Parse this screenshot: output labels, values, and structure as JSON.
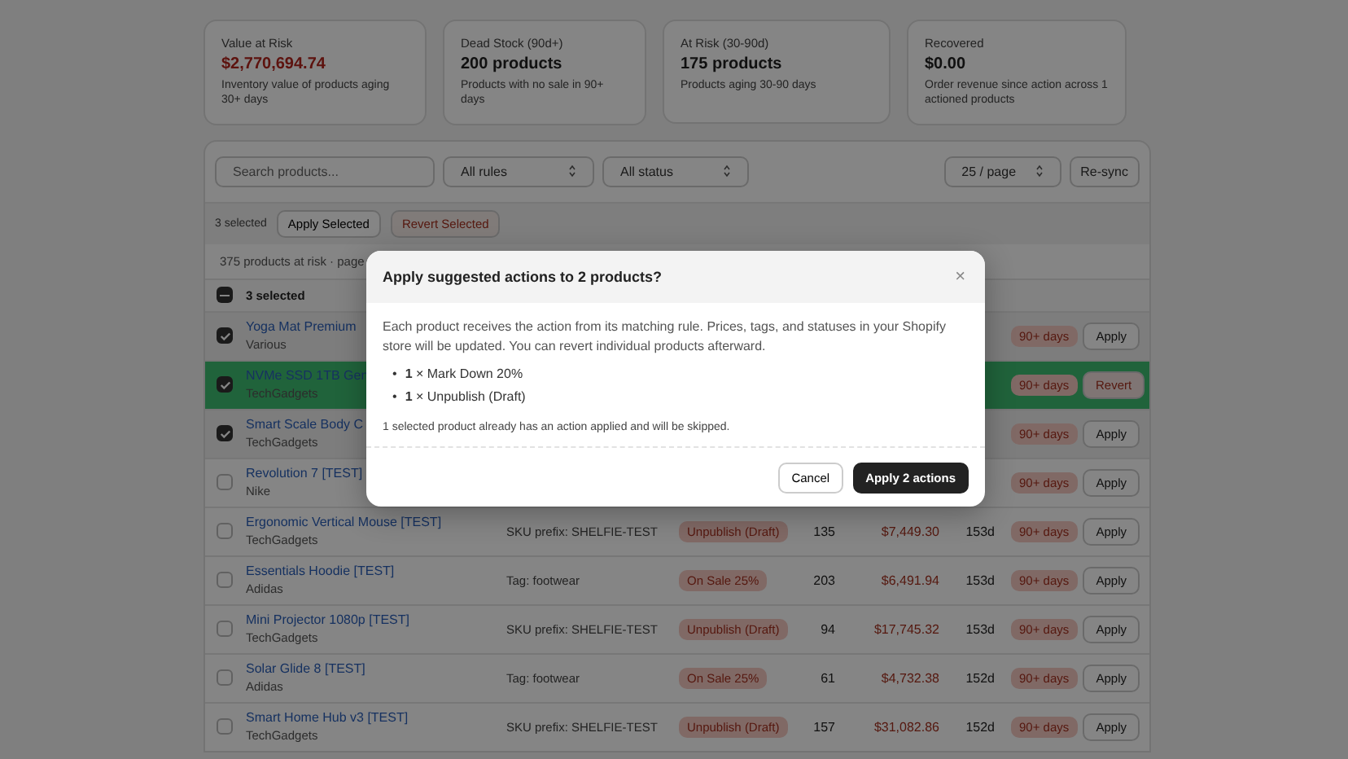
{
  "stats": [
    {
      "label": "Value at Risk",
      "value": "$2,770,694.74",
      "alert": true,
      "note": "Inventory value of products aging 30+ days"
    },
    {
      "label": "Dead Stock (90d+)",
      "value": "200 products",
      "alert": false,
      "note": "Products with no sale in 90+ days"
    },
    {
      "label": "At Risk (30-90d)",
      "value": "175 products",
      "alert": false,
      "note": "Products aging 30-90 days"
    },
    {
      "label": "Recovered",
      "value": "$0.00",
      "alert": false,
      "note": "Order revenue since action across 1 actioned products"
    }
  ],
  "toolbar": {
    "search": {
      "placeholder": "Search products..."
    },
    "rule_filter": "All rules",
    "status_filter": "All status",
    "page_size": "25 / page",
    "resync": "Re-sync"
  },
  "bulk": {
    "count": "3 selected",
    "apply": "Apply Selected",
    "revert": "Revert Selected"
  },
  "summary": "375 products at risk · page",
  "select_all": {
    "label": "3 selected",
    "indeterminate": true
  },
  "rows": [
    {
      "name": "Yoga Mat Premium",
      "vendor": "Various",
      "age_badge": "90+ days",
      "button": "Apply",
      "checked": true,
      "applied": false
    },
    {
      "name": "NVMe SSD 1TB Gen",
      "vendor": "TechGadgets",
      "age_badge": "90+ days",
      "button": "Revert",
      "checked": true,
      "applied": true
    },
    {
      "name": "Smart Scale Body C",
      "vendor": "TechGadgets",
      "age_badge": "90+ days",
      "button": "Apply",
      "checked": true,
      "applied": false
    },
    {
      "name": "Revolution 7 [TEST]",
      "vendor": "Nike",
      "age_badge": "90+ days",
      "button": "Apply",
      "checked": false,
      "applied": false
    },
    {
      "name": "Ergonomic Vertical Mouse [TEST]",
      "vendor": "TechGadgets",
      "rule": "SKU prefix: SHELFIE-TEST",
      "action": "Unpublish (Draft)",
      "quantity": "135",
      "value": "$7,449.30",
      "age": "153d",
      "age_badge": "90+ days",
      "button": "Apply",
      "checked": false,
      "applied": false
    },
    {
      "name": "Essentials Hoodie [TEST]",
      "vendor": "Adidas",
      "rule": "Tag: footwear",
      "action": "On Sale 25%",
      "quantity": "203",
      "value": "$6,491.94",
      "age": "153d",
      "age_badge": "90+ days",
      "button": "Apply",
      "checked": false,
      "applied": false
    },
    {
      "name": "Mini Projector 1080p [TEST]",
      "vendor": "TechGadgets",
      "rule": "SKU prefix: SHELFIE-TEST",
      "action": "Unpublish (Draft)",
      "quantity": "94",
      "value": "$17,745.32",
      "age": "153d",
      "age_badge": "90+ days",
      "button": "Apply",
      "checked": false,
      "applied": false
    },
    {
      "name": "Solar Glide 8 [TEST]",
      "vendor": "Adidas",
      "rule": "Tag: footwear",
      "action": "On Sale 25%",
      "quantity": "61",
      "value": "$4,732.38",
      "age": "152d",
      "age_badge": "90+ days",
      "button": "Apply",
      "checked": false,
      "applied": false
    },
    {
      "name": "Smart Home Hub v3 [TEST]",
      "vendor": "TechGadgets",
      "rule": "SKU prefix: SHELFIE-TEST",
      "action": "Unpublish (Draft)",
      "quantity": "157",
      "value": "$31,082.86",
      "age": "152d",
      "age_badge": "90+ days",
      "button": "Apply",
      "checked": false,
      "applied": false
    }
  ],
  "dialog": {
    "title": "Apply suggested actions to 2 products?",
    "close": "×",
    "body": "Each product receives the action from its matching rule. Prices, tags, and statuses in your Shopify store will be updated. You can revert individual products afterward.",
    "items": [
      {
        "bullet": "•",
        "text": "**1** × Mark Down 20%"
      },
      {
        "bullet": "•",
        "text": "**1** × Unpublish (Draft)"
      }
    ],
    "note": "1 selected product already has an action applied and will be skipped.",
    "cancel": "Cancel",
    "confirm": "Apply 2 actions"
  }
}
